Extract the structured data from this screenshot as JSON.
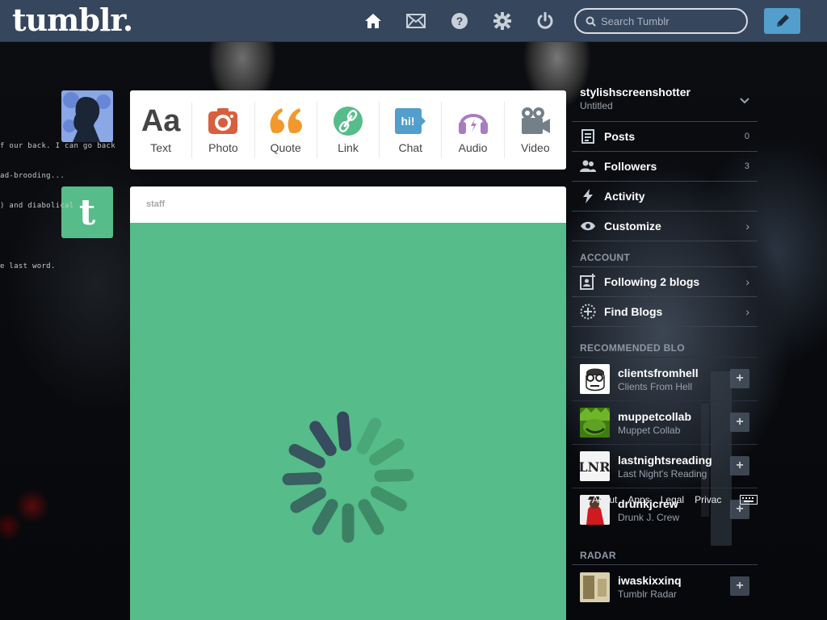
{
  "topbar": {
    "logo": "tumblr.",
    "search_placeholder": "Search Tumblr",
    "icons": [
      "home-icon",
      "mail-icon",
      "help-icon",
      "gear-icon",
      "power-icon",
      "pencil-icon"
    ]
  },
  "left": {
    "snippets": [
      "f our back. I can go back",
      "ad-brooding...",
      ") and diabolical",
      "e last word."
    ]
  },
  "post_types": [
    {
      "label": "Text",
      "icon": "text-icon",
      "color": "#444444"
    },
    {
      "label": "Photo",
      "icon": "camera-icon",
      "color": "#d95e40"
    },
    {
      "label": "Quote",
      "icon": "quote-icon",
      "color": "#f2992e"
    },
    {
      "label": "Link",
      "icon": "link-icon",
      "color": "#56bc8a"
    },
    {
      "label": "Chat",
      "icon": "chat-icon",
      "color": "#529ecc"
    },
    {
      "label": "Audio",
      "icon": "headphones-icon",
      "color": "#a77dc2"
    },
    {
      "label": "Video",
      "icon": "video-camera-icon",
      "color": "#748089"
    }
  ],
  "post": {
    "author": "staff",
    "background": "#56bc8a"
  },
  "sidebar": {
    "blog_name": "stylishscreenshotter",
    "blog_title": "Untitled",
    "items": [
      {
        "label": "Posts",
        "count": "0",
        "icon": "posts-icon"
      },
      {
        "label": "Followers",
        "count": "3",
        "icon": "followers-icon"
      },
      {
        "label": "Activity",
        "icon": "activity-icon"
      },
      {
        "label": "Customize",
        "icon": "eye-icon"
      }
    ],
    "account_title": "ACCOUNT",
    "account_items": [
      {
        "label": "Following 2 blogs",
        "icon": "following-icon"
      },
      {
        "label": "Find Blogs",
        "icon": "compass-icon"
      }
    ],
    "recommended_title": "RECOMMENDED BLO",
    "recommended": [
      {
        "name": "clientsfromhell",
        "sub": "Clients From Hell"
      },
      {
        "name": "muppetcollab",
        "sub": "Muppet Collab"
      },
      {
        "name": "lastnightsreading",
        "sub": "Last Night's Reading"
      },
      {
        "name": "drunkjcrew",
        "sub": "Drunk J. Crew"
      }
    ],
    "radar_title": "RADAR",
    "radar": {
      "name": "iwaskixxinq",
      "sub": "Tumblr Radar"
    }
  },
  "footer": {
    "links": [
      "About",
      "Apps",
      "Legal",
      "Privac"
    ]
  },
  "colors": {
    "topbar": "#36465d",
    "compose": "#529ecc",
    "post_bg": "#56bc8a"
  }
}
